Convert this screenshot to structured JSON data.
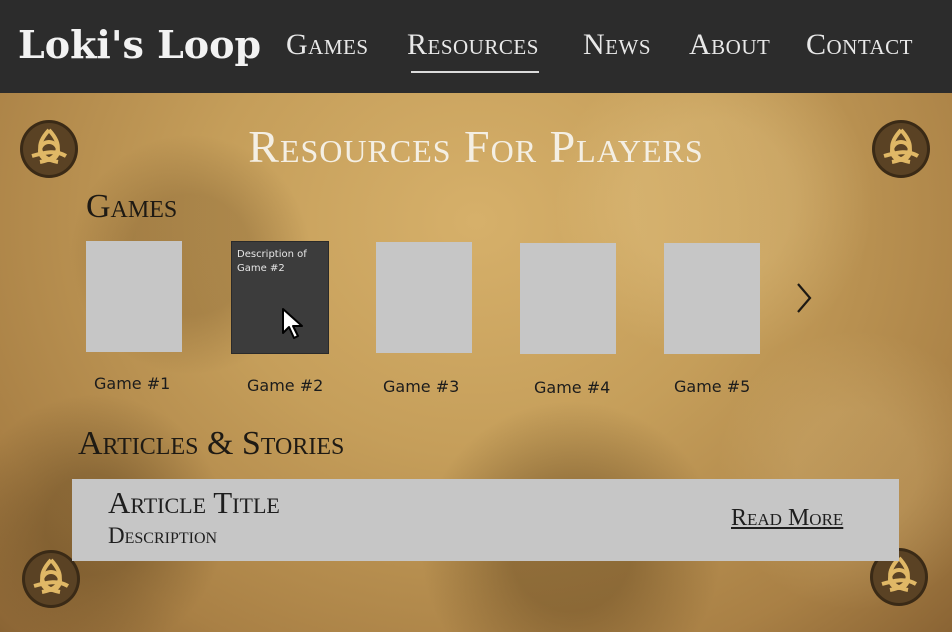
{
  "header": {
    "logo": "Loki's Loop",
    "nav": [
      "Games",
      "Resources",
      "News",
      "About",
      "Contact"
    ],
    "active_nav": "Resources"
  },
  "page_title": "Resources For Players",
  "games_section": {
    "title": "Games",
    "items": [
      {
        "label": "Game #1"
      },
      {
        "label": "Game #2",
        "description": "Description of Game #2",
        "hovered": true
      },
      {
        "label": "Game #3"
      },
      {
        "label": "Game #4"
      },
      {
        "label": "Game #5"
      }
    ],
    "next_icon": "chevron-right-icon"
  },
  "articles_section": {
    "title": "Articles & Stories",
    "items": [
      {
        "title": "Article Title",
        "description": "Description",
        "link": "Read More"
      }
    ]
  },
  "decorations": {
    "corner_icon": "celtic-knot-icon"
  },
  "colors": {
    "header_bg": "#2c2c2c",
    "parchment": "#c59e5a",
    "card": "#c6c6c6",
    "card_hover": "#3c3c3c",
    "knot_gold": "#e0b866"
  }
}
